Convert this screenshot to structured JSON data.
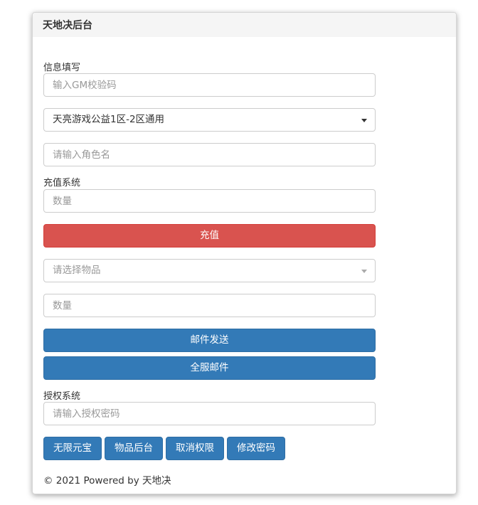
{
  "panel": {
    "title": "天地决后台"
  },
  "info_section": {
    "label": "信息填写",
    "gm_code_placeholder": "输入GM校验码",
    "server_select_value": "天亮游戏公益1区-2区通用",
    "role_name_placeholder": "请输入角色名"
  },
  "recharge_section": {
    "label": "充值系统",
    "amount_placeholder": "数量",
    "recharge_button": "充值"
  },
  "mail_section": {
    "item_select_placeholder": "请选择物品",
    "quantity_placeholder": "数量",
    "send_mail_button": "邮件发送",
    "all_server_mail_button": "全服邮件"
  },
  "auth_section": {
    "label": "授权系统",
    "password_placeholder": "请输入授权密码",
    "buttons": [
      "无限元宝",
      "物品后台",
      "取消权限",
      "修改密码"
    ]
  },
  "footer": {
    "text": "© 2021 Powered by 天地决"
  },
  "colors": {
    "danger": "#d9534f",
    "primary": "#337ab7",
    "heading_bg": "#f5f5f5"
  }
}
